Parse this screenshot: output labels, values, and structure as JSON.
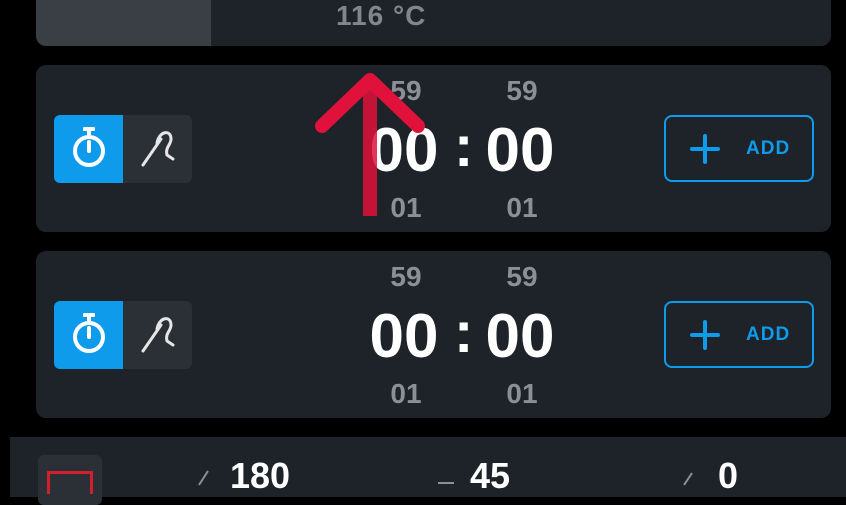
{
  "top_card": {
    "temperature": "116 °C",
    "progress_fraction": 0.22
  },
  "timers": [
    {
      "mode_timer_icon": "stopwatch-icon",
      "mode_probe_icon": "probe-icon",
      "minutes_above": "59",
      "seconds_above": "59",
      "minutes": "00",
      "separator": ":",
      "seconds": "00",
      "minutes_below": "01",
      "seconds_below": "01",
      "add_label": "ADD"
    },
    {
      "mode_timer_icon": "stopwatch-icon",
      "mode_probe_icon": "probe-icon",
      "minutes_above": "59",
      "seconds_above": "59",
      "minutes": "00",
      "separator": ":",
      "seconds": "00",
      "minutes_below": "01",
      "seconds_below": "01",
      "add_label": "ADD"
    }
  ],
  "bottom_bar": {
    "value_1": "180",
    "value_2": "45",
    "value_3": "0"
  },
  "colors": {
    "accent": "#0e9bec",
    "card": "#1d2329",
    "arrow": "#e0123b",
    "grill": "#d21f2b"
  }
}
